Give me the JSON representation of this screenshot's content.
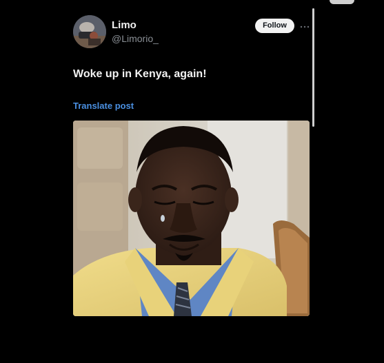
{
  "post": {
    "author": {
      "display_name": "Limo",
      "handle": "@Limorio_"
    },
    "follow_label": "Follow",
    "text": "Woke up in Kenya, again!",
    "translate_label": "Translate post",
    "media_icon": "photo-of-crying-man-in-yellow-suit"
  },
  "icons": {
    "more": "more-horizontal-icon"
  },
  "colors": {
    "background": "#000000",
    "link": "#4a8fe0",
    "follow_button_bg": "#f2f2f2",
    "secondary_text": "#8b9096"
  }
}
